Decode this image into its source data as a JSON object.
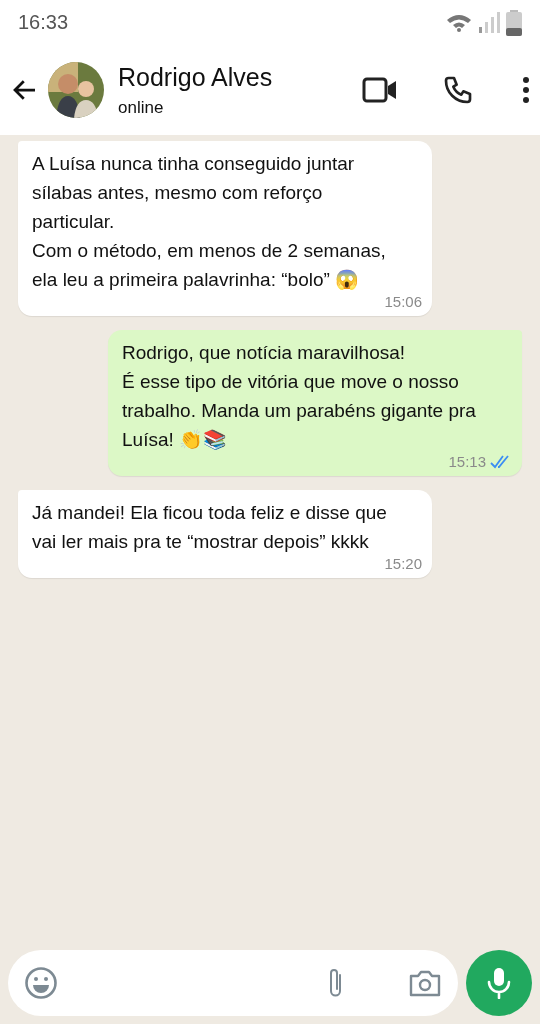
{
  "status_bar": {
    "time": "16:33"
  },
  "header": {
    "name": "Rodrigo Alves",
    "status": "online"
  },
  "messages": [
    {
      "kind": "received",
      "text": "A Luísa nunca tinha conseguido juntar sílabas antes, mesmo com reforço particular.\nCom o método, em menos de 2 semanas, ela leu a primeira palavrinha: “bolo” 😱",
      "time": "15:06"
    },
    {
      "kind": "sent",
      "text": "Rodrigo, que notícia maravilhosa!\nÉ esse tipo de vitória que move o nosso trabalho. Manda um parabéns gigante pra Luísa! 👏📚",
      "time": "15:13",
      "read": true
    },
    {
      "kind": "received",
      "text": "Já mandei! Ela ficou toda feliz e disse que vai ler mais pra te “mostrar depois” kkkk",
      "time": "15:20"
    }
  ]
}
